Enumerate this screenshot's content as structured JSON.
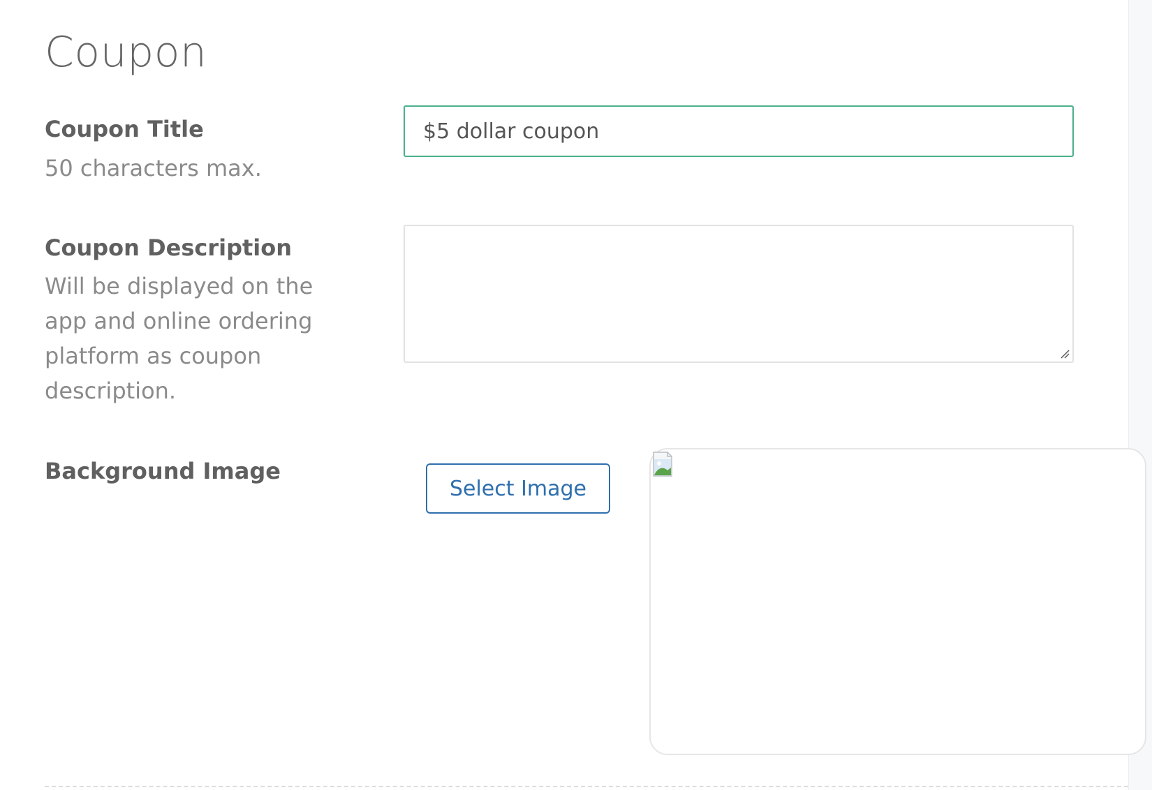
{
  "page": {
    "title": "Coupon"
  },
  "fields": {
    "coupon_title": {
      "label": "Coupon Title",
      "help": "50 characters max.",
      "value": "$5 dollar coupon"
    },
    "coupon_description": {
      "label": "Coupon Description",
      "help": "Will be displayed on the app and online ordering platform as coupon description.",
      "value": ""
    },
    "background_image": {
      "label": "Background Image",
      "button_label": "Select Image",
      "preview_icon": "broken-image-icon"
    }
  },
  "colors": {
    "active_border": "#4cb08a",
    "button_accent": "#2f6fae",
    "label_text": "#606060",
    "help_text": "#8a8a8a"
  }
}
